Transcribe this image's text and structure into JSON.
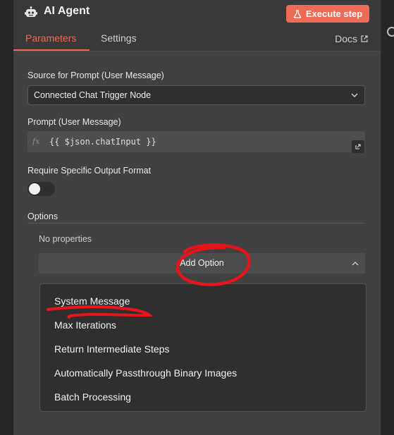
{
  "header": {
    "title": "AI Agent",
    "execute_label": "Execute step",
    "icons": {
      "node": "robot-icon",
      "execute": "flask-icon"
    },
    "accent_color": "#ed6a55"
  },
  "tabs": [
    {
      "label": "Parameters",
      "active": true
    },
    {
      "label": "Settings",
      "active": false
    }
  ],
  "docs": {
    "label": "Docs",
    "icon": "external-link-icon"
  },
  "form": {
    "source_label": "Source for Prompt (User Message)",
    "source_value": "Connected Chat Trigger Node",
    "prompt_label": "Prompt (User Message)",
    "prompt_fx": "fx",
    "prompt_value": "{{ $json.chatInput }}",
    "output_format_label": "Require Specific Output Format",
    "output_format_enabled": false
  },
  "options": {
    "label": "Options",
    "empty_text": "No properties",
    "add_label": "Add Option",
    "items": [
      "System Message",
      "Max Iterations",
      "Return Intermediate Steps",
      "Automatically Passthrough Binary Images",
      "Batch Processing"
    ]
  },
  "annotation_color": "#e8141b"
}
